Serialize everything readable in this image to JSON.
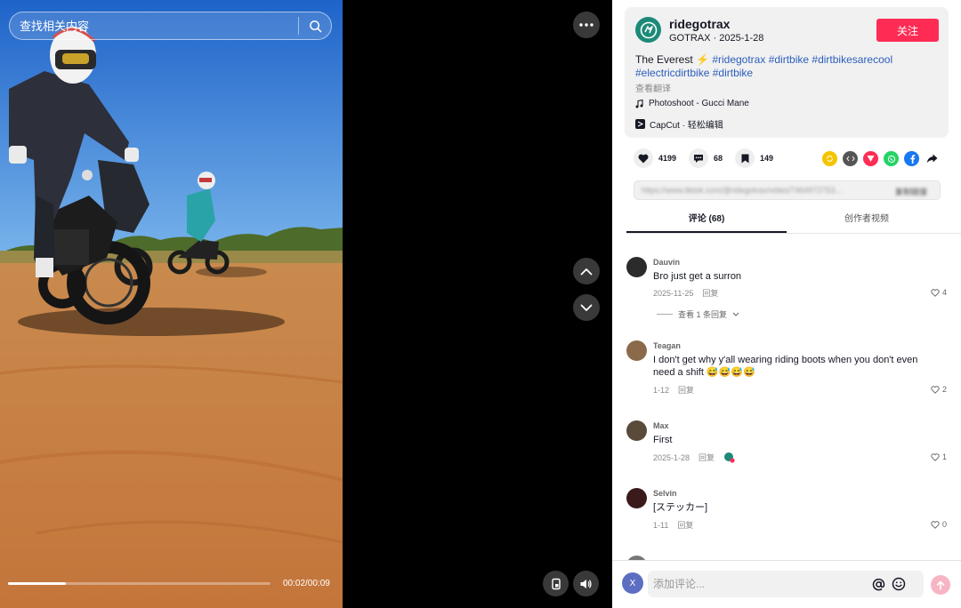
{
  "search": {
    "placeholder": "查找相关内容"
  },
  "video": {
    "time": "00:02/00:09",
    "progress_fraction": 0.22
  },
  "author": {
    "username": "ridegotrax",
    "subline": "GOTRAX · 2025-1-28",
    "follow_label": "关注"
  },
  "caption": {
    "text": "The Everest ⚡",
    "hashtags": [
      "#ridegotrax",
      "#dirtbike",
      "#dirtbikesarecool",
      "#electricdirtbike",
      "#dirtbike"
    ],
    "translate_label": "查看翻译"
  },
  "music": {
    "label": "Photoshoot - Gucci Mane"
  },
  "capcut": {
    "label": "CapCut · 轻松编辑"
  },
  "stats": {
    "likes": "4199",
    "comments": "68",
    "bookmarks": "149"
  },
  "share_icons": [
    {
      "name": "repost-icon",
      "color": "#f5c400"
    },
    {
      "name": "embed-icon",
      "color": "#555555"
    },
    {
      "name": "send-icon",
      "color": "#fe2c55"
    },
    {
      "name": "whatsapp-icon",
      "color": "#25d366"
    },
    {
      "name": "facebook-icon",
      "color": "#1877f2"
    },
    {
      "name": "share-arrow-icon",
      "color": "#161823"
    }
  ],
  "link": {
    "url": "https://www.tiktok.com/@ridegotrax/video/7464972753...",
    "copy_label": "复制链接"
  },
  "tabs": {
    "comments": "评论 (68)",
    "creator_videos": "创作者视频"
  },
  "comments": [
    {
      "name": "Dauvin",
      "text": "Bro just get a surron",
      "date": "2025-11-25",
      "reply_label": "回复",
      "likes": "4",
      "view_replies": "查看 1 条回复",
      "avatar_color": "#2b2b2b"
    },
    {
      "name": "Teagan",
      "text": "I don't get why y'all wearing riding boots when you don't even need a shift 😅😅😅😅",
      "date": "1-12",
      "reply_label": "回复",
      "likes": "2",
      "avatar_color": "#8a6a4a"
    },
    {
      "name": "Max",
      "text": "First",
      "date": "2025-1-28",
      "reply_label": "回复",
      "likes": "1",
      "avatar_color": "#5a4a3a"
    },
    {
      "name": "Selvin",
      "text": "[ステッカー]",
      "date": "1-11",
      "reply_label": "回复",
      "likes": "0",
      "avatar_color": "#3a1a1a"
    }
  ],
  "composer": {
    "placeholder": "添加评论...",
    "me_initial": "X"
  }
}
